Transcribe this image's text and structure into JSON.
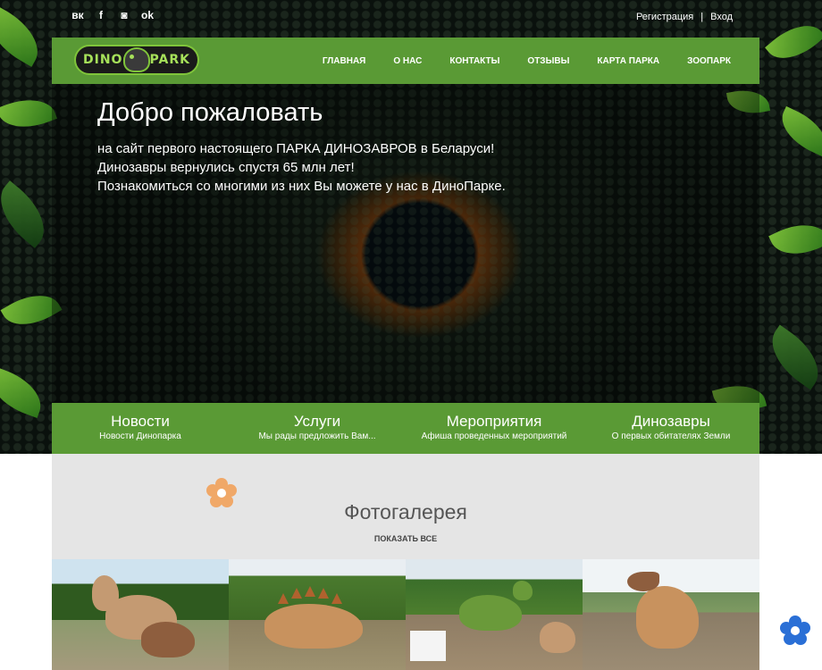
{
  "topbar": {
    "social": [
      {
        "icon": "vk-icon",
        "glyph": "вк"
      },
      {
        "icon": "facebook-icon",
        "glyph": "f"
      },
      {
        "icon": "instagram-icon",
        "glyph": "◙"
      },
      {
        "icon": "odnoklassniki-icon",
        "glyph": "ok"
      }
    ],
    "register_label": "Регистрация",
    "separator": "|",
    "login_label": "Вход"
  },
  "nav": {
    "logo_left": "DINO",
    "logo_right": "PARK",
    "items": [
      "ГЛАВНАЯ",
      "О НАС",
      "КОНТАКТЫ",
      "ОТЗЫВЫ",
      "КАРТА ПАРКА",
      "ЗООПАРК"
    ]
  },
  "hero": {
    "title": "Добро пожаловать",
    "lines": [
      "на сайт первого настоящего ПАРКА ДИНОЗАВРОВ в Беларуси!",
      "Динозавры вернулись спустя 65 млн лет!",
      "Познакомиться со многими из них Вы можете у нас в ДиноПарке."
    ]
  },
  "features": [
    {
      "title": "Новости",
      "subtitle": "Новости Динопарка"
    },
    {
      "title": "Услуги",
      "subtitle": "Мы рады предложить Вам..."
    },
    {
      "title": "Мероприятия",
      "subtitle": "Афиша проведенных мероприятий"
    },
    {
      "title": "Динозавры",
      "subtitle": "О первых обитателях Земли"
    }
  ],
  "gallery": {
    "title": "Фотогалерея",
    "show_all_label": "ПОКАЗАТЬ ВСЕ",
    "photos": [
      "gallery-photo-1",
      "gallery-photo-2",
      "gallery-photo-3",
      "gallery-photo-4"
    ]
  },
  "colors": {
    "brand_green": "#5a9a35",
    "logo_accent": "#7fc43a",
    "flower_orange": "#f0a868",
    "flower_blue": "#2a6fd6"
  }
}
